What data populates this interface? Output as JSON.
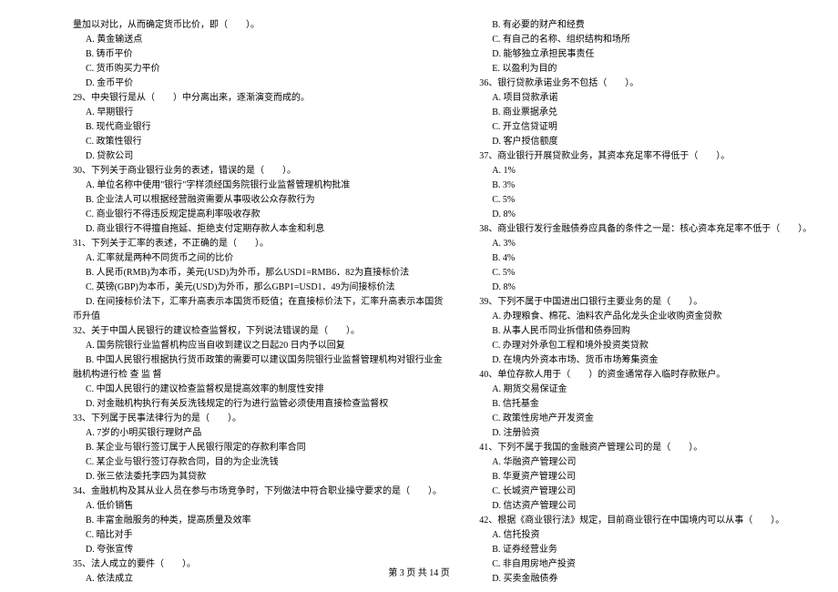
{
  "left": [
    {
      "indent": 0,
      "text": "量加以对比，从而确定货币比价，即（　　）。"
    },
    {
      "indent": 1,
      "text": "A. 黄金输送点"
    },
    {
      "indent": 1,
      "text": "B. 铸币平价"
    },
    {
      "indent": 1,
      "text": "C. 货币购买力平价"
    },
    {
      "indent": 1,
      "text": "D. 金币平价"
    },
    {
      "indent": 0,
      "text": "29、中央银行是从（　　）中分离出来，逐渐演变而成的。"
    },
    {
      "indent": 1,
      "text": "A. 早期银行"
    },
    {
      "indent": 1,
      "text": "B. 现代商业银行"
    },
    {
      "indent": 1,
      "text": "C. 政策性银行"
    },
    {
      "indent": 1,
      "text": "D. 贷款公司"
    },
    {
      "indent": 0,
      "text": "30、下列关于商业银行业务的表述，错误的是（　　）。"
    },
    {
      "indent": 1,
      "text": "A. 单位名称中使用\"银行\"字样须经国务院银行业监督管理机构批准"
    },
    {
      "indent": 1,
      "text": "B. 企业法人可以根据经营融资需要从事吸收公众存款行为"
    },
    {
      "indent": 1,
      "text": "C. 商业银行不得违反规定提高利率吸收存款"
    },
    {
      "indent": 1,
      "text": "D. 商业银行不得擅自拖延、拒绝支付定期存款人本金和利息"
    },
    {
      "indent": 0,
      "text": "31、下列关于汇率的表述，不正确的是（　　）。"
    },
    {
      "indent": 1,
      "text": "A. 汇率就是两种不同货币之间的比价"
    },
    {
      "indent": 1,
      "text": "B. 人民币(RMB)为本币，美元(USD)为外币，那么USD1=RMB6．82为直接标价法"
    },
    {
      "indent": 1,
      "text": "C. 英镑(GBP)为本币，美元(USD)为外币，那么GBP1=USD1．49为间接标价法"
    },
    {
      "indent": 1,
      "text": "D. 在间接标价法下，汇率升高表示本国货币贬值；在直接标价法下，汇率升高表示本国货"
    },
    {
      "indent": 0,
      "text": "币升值"
    },
    {
      "indent": 0,
      "text": "32、关于中国人民银行的建议检查监督权，下列说法错误的是（　　）。"
    },
    {
      "indent": 1,
      "text": "A. 国务院银行业监督机构应当自收到建议之日起20 日内予以回复"
    },
    {
      "indent": 1,
      "text": "B. 中国人民银行根据执行货币政策的需要可以建议国务院银行业监督管理机构对银行业金"
    },
    {
      "indent": 0,
      "text": "融机构进行检 查 监 督"
    },
    {
      "indent": 1,
      "text": "C. 中国人民银行的建议检查监督权是提高效率的制度性安排"
    },
    {
      "indent": 1,
      "text": "D. 对金融机构执行有关反洗钱规定的行为进行监管必须使用直接检查监督权"
    },
    {
      "indent": 0,
      "text": "33、下列属于民事法律行为的是（　　）。"
    },
    {
      "indent": 1,
      "text": "A. 7岁的小明买银行理财产品"
    },
    {
      "indent": 1,
      "text": "B. 某企业与银行签订属于人民银行限定的存款利率合同"
    },
    {
      "indent": 1,
      "text": "C. 某企业与银行签订存款合同，目的为企业洗钱"
    },
    {
      "indent": 1,
      "text": "D. 张三依法委托李四为其贷款"
    },
    {
      "indent": 0,
      "text": "34、金融机构及其从业人员在参与市场竞争时，下列做法中符合职业操守要求的是（　　）。"
    },
    {
      "indent": 1,
      "text": "A. 低价销售"
    },
    {
      "indent": 1,
      "text": "B. 丰富金融服务的种类，提高质量及效率"
    },
    {
      "indent": 1,
      "text": "C. 暗比对手"
    },
    {
      "indent": 1,
      "text": "D. 夸张宣传"
    },
    {
      "indent": 0,
      "text": "35、法人成立的要件（　　）。"
    },
    {
      "indent": 1,
      "text": "A. 依法成立"
    }
  ],
  "right": [
    {
      "indent": 1,
      "text": "B. 有必要的财产和经费"
    },
    {
      "indent": 1,
      "text": "C. 有自己的名称、组织结构和场所"
    },
    {
      "indent": 1,
      "text": "D. 能够独立承担民事责任"
    },
    {
      "indent": 1,
      "text": "E. 以盈利为目的"
    },
    {
      "indent": 0,
      "text": "36、银行贷款承诺业务不包括（　　）。"
    },
    {
      "indent": 1,
      "text": "A. 项目贷款承诺"
    },
    {
      "indent": 1,
      "text": "B. 商业票据承兑"
    },
    {
      "indent": 1,
      "text": "C. 开立信贷证明"
    },
    {
      "indent": 1,
      "text": "D. 客户授信额度"
    },
    {
      "indent": 0,
      "text": "37、商业银行开展贷款业务，其资本充足率不得低于（　　）。"
    },
    {
      "indent": 1,
      "text": "A. 1%"
    },
    {
      "indent": 1,
      "text": "B. 3%"
    },
    {
      "indent": 1,
      "text": "C. 5%"
    },
    {
      "indent": 1,
      "text": "D. 8%"
    },
    {
      "indent": 0,
      "text": "38、商业银行发行金融债券应具备的条件之一是：核心资本充足率不低于（　　）。"
    },
    {
      "indent": 1,
      "text": "A. 3%"
    },
    {
      "indent": 1,
      "text": "B. 4%"
    },
    {
      "indent": 1,
      "text": "C. 5%"
    },
    {
      "indent": 1,
      "text": "D. 8%"
    },
    {
      "indent": 0,
      "text": "39、下列不属于中国进出口银行主要业务的是（　　）。"
    },
    {
      "indent": 1,
      "text": "A. 办理粮食、棉花、油料农产品化龙头企业收购资金贷款"
    },
    {
      "indent": 1,
      "text": "B. 从事人民币同业拆借和债券回购"
    },
    {
      "indent": 1,
      "text": "C. 办理对外承包工程和境外投资类贷款"
    },
    {
      "indent": 1,
      "text": "D. 在境内外资本市场、货币市场筹集资金"
    },
    {
      "indent": 0,
      "text": "40、单位存款人用于（　　）的资金通常存入临时存款账户。"
    },
    {
      "indent": 1,
      "text": "A. 期货交易保证金"
    },
    {
      "indent": 1,
      "text": "B. 信托基金"
    },
    {
      "indent": 1,
      "text": "C. 政策性房地产开发资金"
    },
    {
      "indent": 1,
      "text": "D. 注册验资"
    },
    {
      "indent": 0,
      "text": "41、下列不属于我国的金融资产管理公司的是（　　）。"
    },
    {
      "indent": 1,
      "text": "A. 华融资产管理公司"
    },
    {
      "indent": 1,
      "text": "B. 华夏资产管理公司"
    },
    {
      "indent": 1,
      "text": "C. 长城资产管理公司"
    },
    {
      "indent": 1,
      "text": "D. 信达资产管理公司"
    },
    {
      "indent": 0,
      "text": "42、根据《商业银行法》规定，目前商业银行在中国境内可以从事（　　）。"
    },
    {
      "indent": 1,
      "text": "A. 信托投资"
    },
    {
      "indent": 1,
      "text": "B. 证券经营业务"
    },
    {
      "indent": 1,
      "text": "C. 非自用房地产投资"
    },
    {
      "indent": 1,
      "text": "D. 买卖金融债券"
    }
  ],
  "footer": "第 3 页 共 14 页"
}
